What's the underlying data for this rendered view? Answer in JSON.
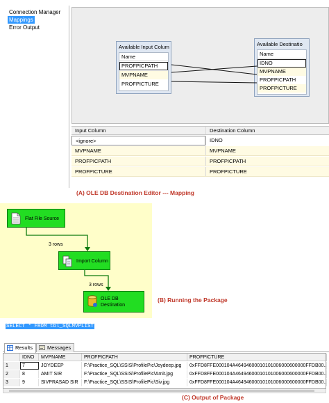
{
  "editor": {
    "nav_items": [
      "Connection Manager",
      "Mappings",
      "Error Output"
    ],
    "selected_nav": "Mappings",
    "input_box": {
      "title": "Available Input Colum",
      "header": "Name",
      "rows": [
        "PROFPICPATH",
        "MVPNAME",
        "PROFPICTURE"
      ]
    },
    "dest_box": {
      "title": "Available Destinatio",
      "header": "Name",
      "rows": [
        "IDNO",
        "MVPNAME",
        "PROFPICPATH",
        "PROFPICTURE"
      ]
    },
    "grid": {
      "headers": [
        "Input Column",
        "Destination Column"
      ],
      "rows": [
        [
          "<ignore>",
          "IDNO"
        ],
        [
          "MVPNAME",
          "MVPNAME"
        ],
        [
          "PROFPICPATH",
          "PROFPICPATH"
        ],
        [
          "PROFPICTURE",
          "PROFPICTURE"
        ]
      ]
    },
    "caption": "(A) OLE DB Destination Editor --- Mapping"
  },
  "flow": {
    "tasks": [
      "Flat File Source",
      "Import Column",
      "OLE DB\nDestination"
    ],
    "rows_labels": [
      "3 rows",
      "3 rows"
    ],
    "caption": "(B) Running the Package"
  },
  "output": {
    "sql": "SELECT * FROM tbl_SQLMVPLIST",
    "tabs": [
      "Results",
      "Messages"
    ],
    "columns": [
      "IDNO",
      "MVPNAME",
      "PROFPICPATH",
      "PROFPICTURE"
    ],
    "rows": [
      [
        "1",
        "7",
        "JOYDEEP",
        "F:\\Practice_SQL\\SSIS\\ProfilePic\\Joydeep.jpg",
        "0xFFD8FFE000104A46494600010101006000600000FFDB00..."
      ],
      [
        "2",
        "8",
        "AMIT SIR",
        "F:\\Practice_SQL\\SSIS\\ProfilePic\\Amit.jpg",
        "0xFFD8FFE000104A46494600010101006000600000FFDB00..."
      ],
      [
        "3",
        "9",
        "SIVPRASAD SIR",
        "F:\\Practice_SQL\\SSIS\\ProfilePic\\Siv.jpg",
        "0xFFD8FFE000104A46494600010101006000600000FFDB00..."
      ]
    ],
    "caption": "(C) Output of Package"
  },
  "colors": {
    "task_green": "#22dd22",
    "flow_background": "#fffec9",
    "selection_blue": "#3399ff",
    "caption_red": "#c0392b"
  }
}
